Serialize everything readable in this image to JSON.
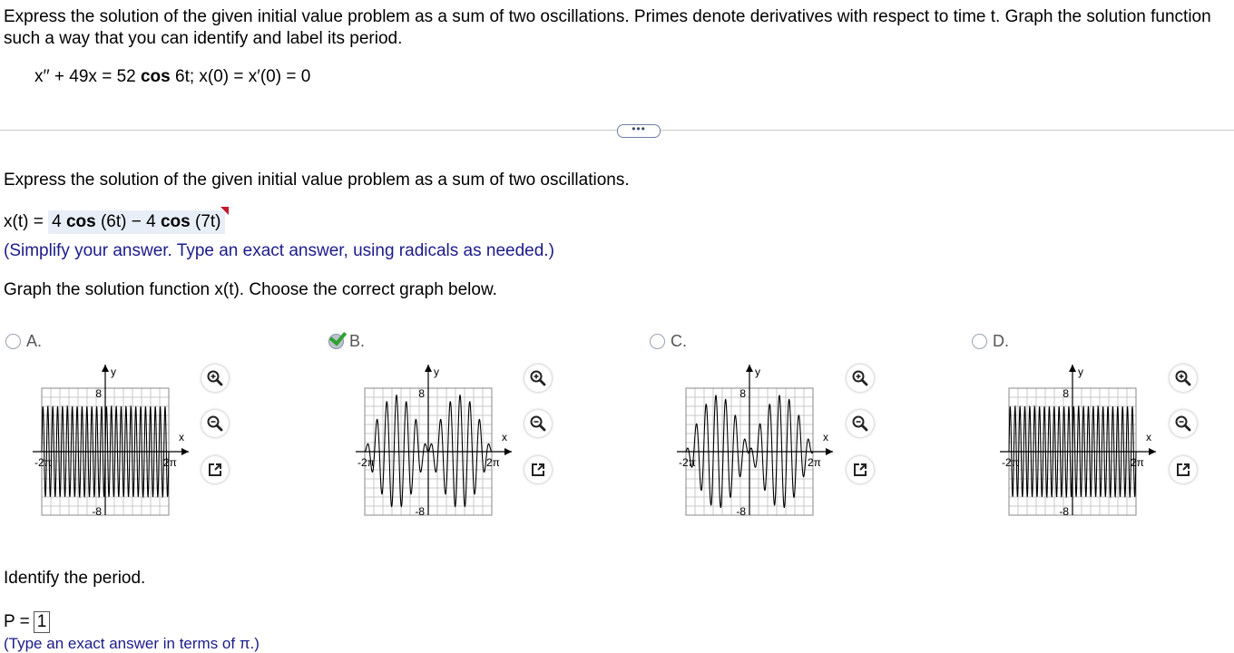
{
  "question": {
    "line1": "Express the solution of the given initial value problem as a sum of two oscillations. Primes denote derivatives with respect to time t. Graph the solution function",
    "line2": "such a way that you can identify and label its period.",
    "equation": {
      "lhs": "x′′ + 49x = 52 ",
      "cos": "cos",
      "rhs": " 6t; x(0) = x′(0) = 0"
    }
  },
  "more_button": "•••",
  "part1": {
    "prompt": "Express the solution of the given initial value problem as a sum of two oscillations.",
    "answer_prefix": "x(t) = ",
    "answer": {
      "a": "4 ",
      "cos1": "cos",
      "b": " (6t) − 4 ",
      "cos2": "cos",
      "c": " (7t)"
    },
    "hint": "(Simplify your answer. Type an exact answer, using radicals as needed.)"
  },
  "part2": {
    "prompt": "Graph the solution function x(t). Choose the correct graph below.",
    "selected": "B",
    "choices": [
      {
        "label": "A.",
        "variant": "fast",
        "selected": false
      },
      {
        "label": "B.",
        "variant": "beat",
        "selected": true
      },
      {
        "label": "C.",
        "variant": "beat2",
        "selected": false
      },
      {
        "label": "D.",
        "variant": "fast",
        "selected": false
      }
    ],
    "axis": {
      "y_label": "y",
      "x_label": "x",
      "y_top": "8",
      "y_bottom": "-8",
      "x_left": "-2π",
      "x_right": "2π",
      "xlim": [
        -6.283,
        6.283
      ],
      "ylim": [
        -9,
        9
      ]
    },
    "tool_icons": [
      "zoom-in-icon",
      "zoom-out-icon",
      "open-window-icon"
    ]
  },
  "part3": {
    "prompt": "Identify the period.",
    "answer_prefix": "P =",
    "answer": "1",
    "hint_cut": "(Type an exact answer in terms of π.)"
  },
  "colors": {
    "hint_text": "#1b1b8c",
    "answer_bg": "#e8eef7",
    "flag": "#c2182b",
    "check": "#2ea12e"
  }
}
